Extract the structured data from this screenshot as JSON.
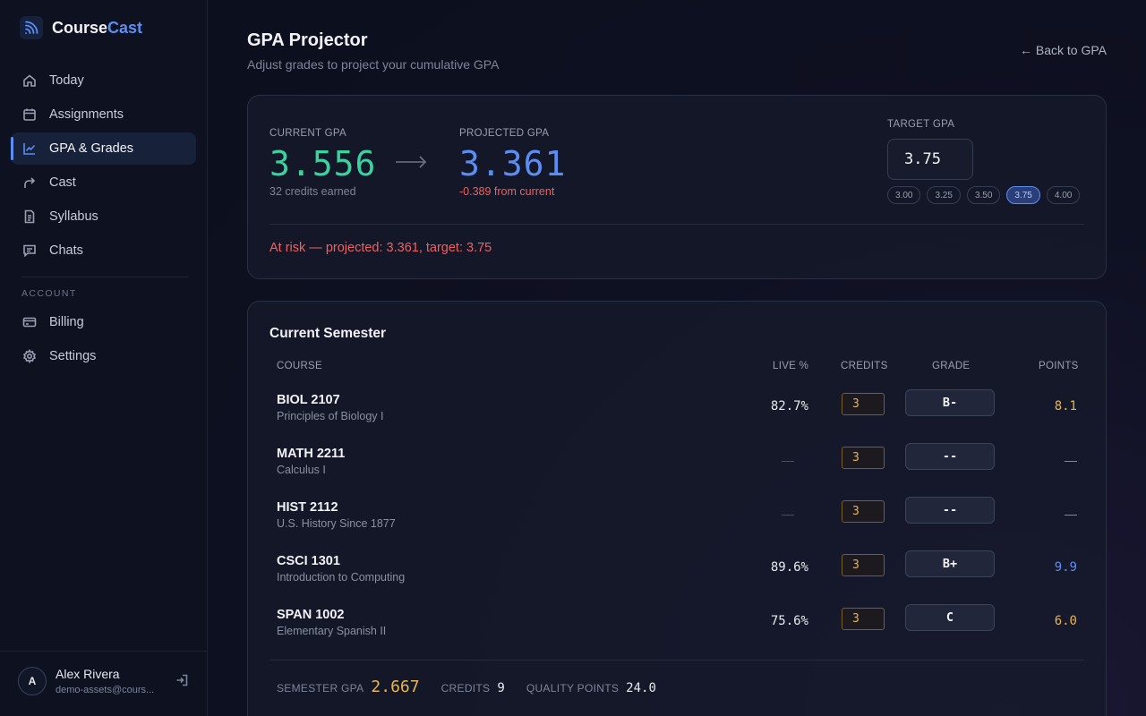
{
  "brand": {
    "prefix": "Course",
    "suffix": "Cast"
  },
  "nav": {
    "items": [
      {
        "label": "Today",
        "icon": "home-icon"
      },
      {
        "label": "Assignments",
        "icon": "calendar-icon"
      },
      {
        "label": "GPA & Grades",
        "icon": "chart-icon",
        "active": true
      },
      {
        "label": "Cast",
        "icon": "share-icon"
      },
      {
        "label": "Syllabus",
        "icon": "document-icon"
      },
      {
        "label": "Chats",
        "icon": "chat-icon"
      }
    ],
    "account_label": "ACCOUNT",
    "account_items": [
      {
        "label": "Billing",
        "icon": "credit-card-icon"
      },
      {
        "label": "Settings",
        "icon": "gear-icon"
      }
    ]
  },
  "user": {
    "initial": "A",
    "name": "Alex Rivera",
    "email": "demo-assets@cours..."
  },
  "header": {
    "title": "GPA Projector",
    "subtitle": "Adjust grades to project your cumulative GPA",
    "back_label": "← Back to GPA"
  },
  "gpa": {
    "current_label": "CURRENT GPA",
    "current_value": "3.556",
    "current_note": "32 credits earned",
    "projected_label": "PROJECTED GPA",
    "projected_value": "3.361",
    "projected_note": "-0.389 from current",
    "target_label": "TARGET GPA",
    "target_value": "3.75",
    "target_options": [
      "3.00",
      "3.25",
      "3.50",
      "3.75",
      "4.00"
    ],
    "selected_option": "3.75",
    "risk_message": "At risk — projected: 3.361, target: 3.75"
  },
  "semester": {
    "title": "Current Semester",
    "columns": {
      "course": "COURSE",
      "live": "LIVE %",
      "credits": "CREDITS",
      "grade": "GRADE",
      "points": "POINTS"
    },
    "rows": [
      {
        "code": "BIOL 2107",
        "name": "Principles of Biology I",
        "live": "82.7%",
        "credits": "3",
        "grade": "B-",
        "points": "8.1"
      },
      {
        "code": "MATH 2211",
        "name": "Calculus I",
        "live": "—",
        "credits": "3",
        "grade": "--",
        "points": "—"
      },
      {
        "code": "HIST 2112",
        "name": "U.S. History Since 1877",
        "live": "—",
        "credits": "3",
        "grade": "--",
        "points": "—"
      },
      {
        "code": "CSCI 1301",
        "name": "Introduction to Computing",
        "live": "89.6%",
        "credits": "3",
        "grade": "B+",
        "points": "9.9"
      },
      {
        "code": "SPAN 1002",
        "name": "Elementary Spanish II",
        "live": "75.6%",
        "credits": "3",
        "grade": "C",
        "points": "6.0"
      }
    ],
    "summary": {
      "gpa_label": "SEMESTER GPA",
      "gpa_value": "2.667",
      "credits_label": "CREDITS",
      "credits_value": "9",
      "qp_label": "QUALITY POINTS",
      "qp_value": "24.0"
    }
  },
  "colors": {
    "accent": "#5b8ef5",
    "current_gpa": "#3ad29f",
    "risk": "#f0605e",
    "credits": "#e8b44f",
    "points_colors": [
      "#e8b44f",
      "#8a90a2",
      "#8a90a2",
      "#5b8ef5",
      "#e8b44f"
    ]
  }
}
